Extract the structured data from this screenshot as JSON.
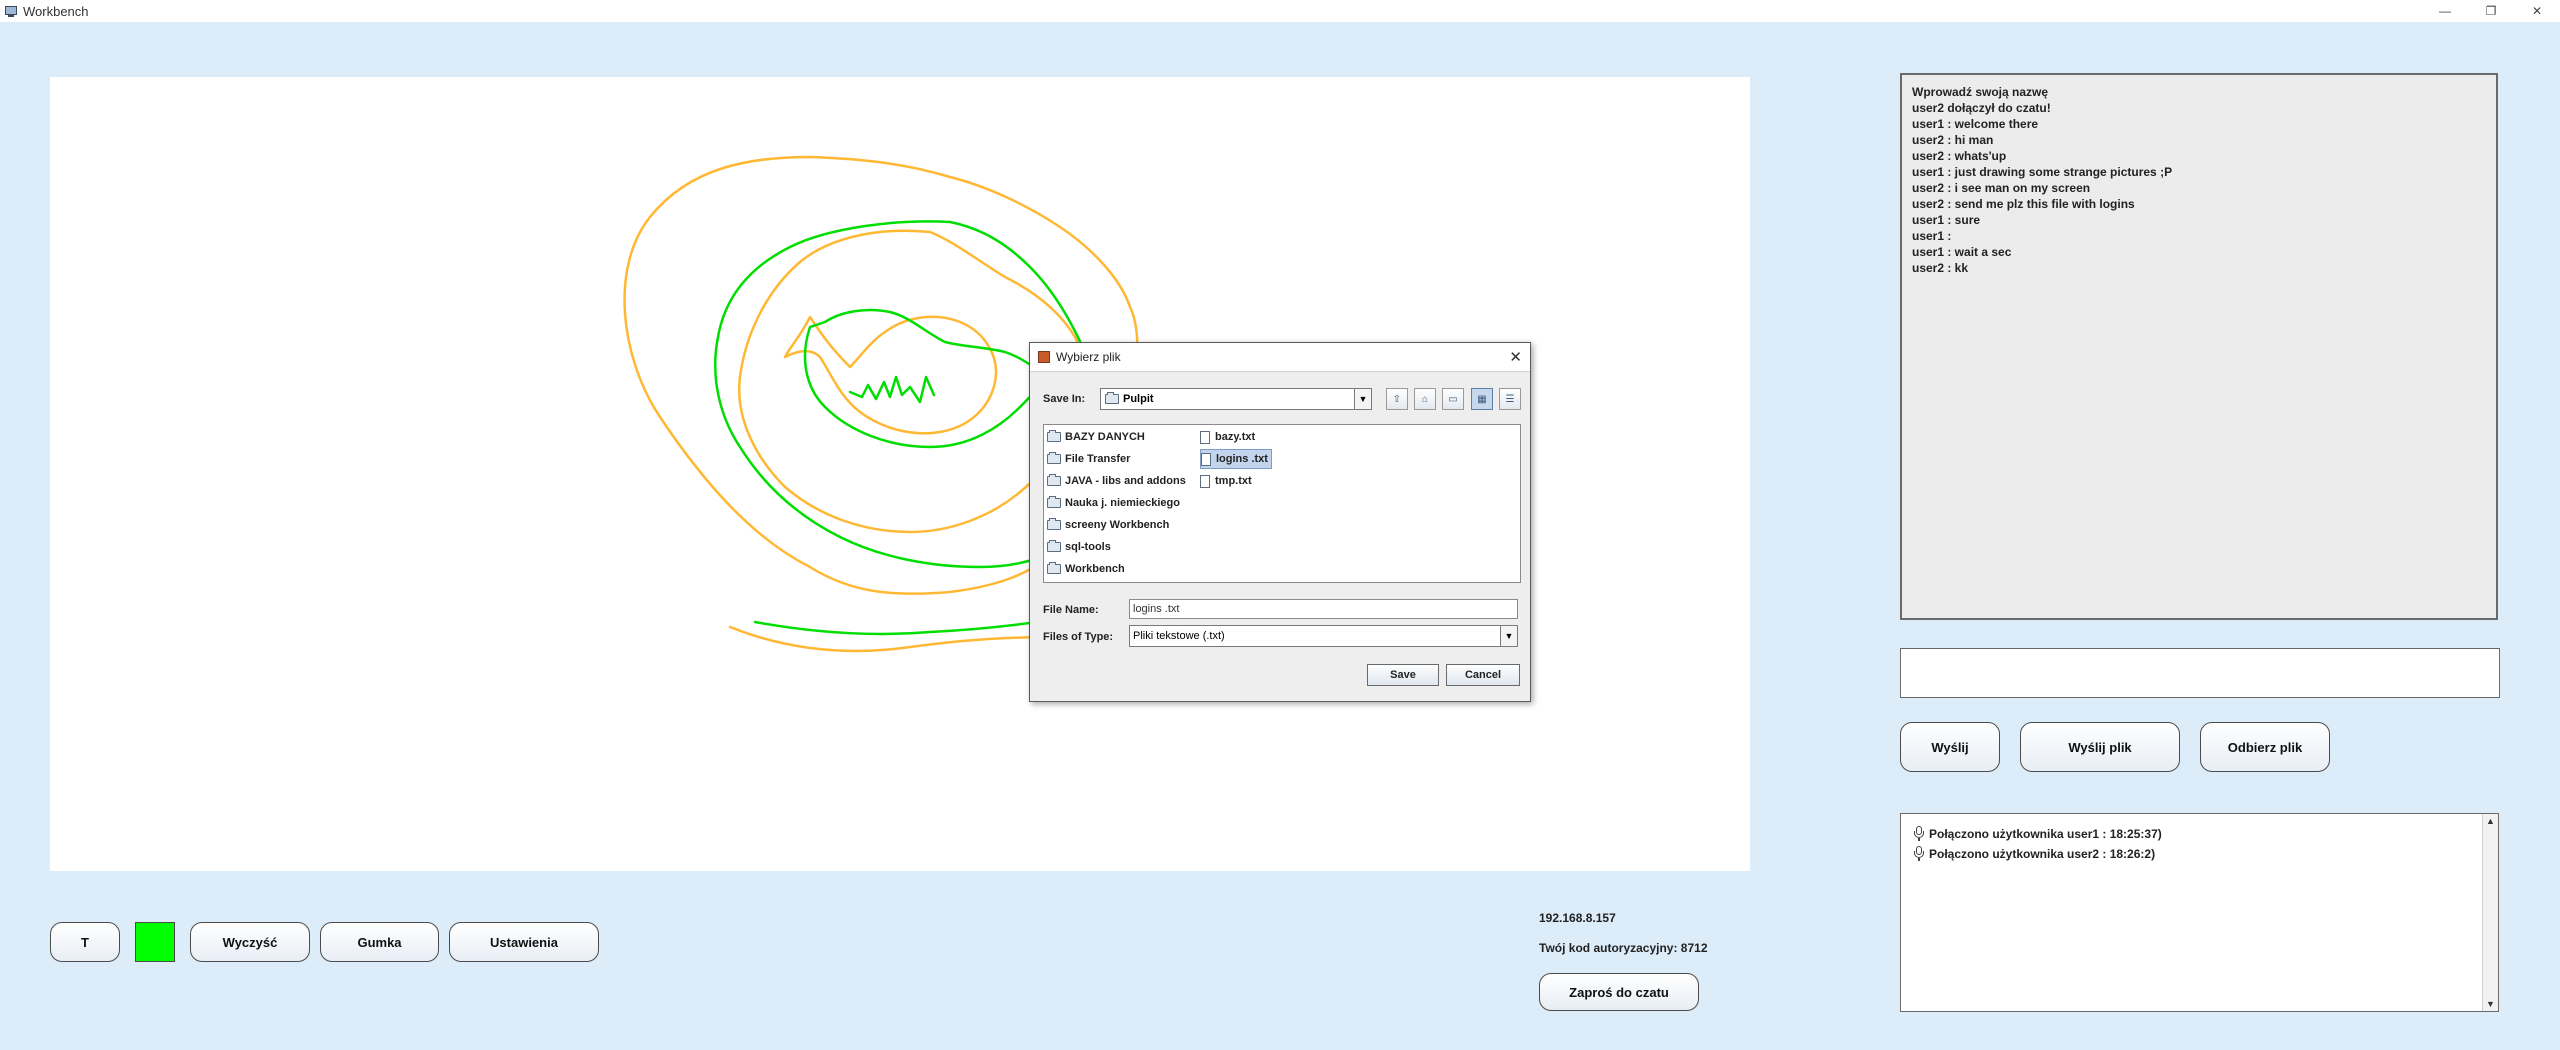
{
  "window": {
    "title": "Workbench",
    "controls": [
      "—",
      "❐",
      "✕"
    ]
  },
  "toolbar": {
    "text_tool_label": "T",
    "current_color": "#00ff00",
    "clear_label": "Wyczyść",
    "eraser_label": "Gumka",
    "settings_label": "Ustawienia"
  },
  "info": {
    "ip": "192.168.8.157",
    "auth_code": "Twój kod autoryzacyjny: 8712",
    "invite_label": "Zaproś do czatu"
  },
  "chat": {
    "lines": [
      "Wprowadź swoją nazwę",
      "user2 dołączył do czatu!",
      "user1 : welcome there",
      "user2 : hi man",
      "user2 : whats'up",
      "user1 : just drawing some strange pictures ;P",
      "user2 : i see man on my screen",
      "user2 : send me plz this file with logins",
      "user1 : sure",
      "user1 : ",
      "user1 : wait a sec",
      "user2 : kk"
    ],
    "input_value": "",
    "send_label": "Wyślij",
    "send_file_label": "Wyślij plik",
    "receive_file_label": "Odbierz plik"
  },
  "status": {
    "lines": [
      "Połączono użytkownika user1 : 18:25:37)",
      "Połączono użytkownika user2 : 18:26:2)"
    ]
  },
  "dialog": {
    "title": "Wybierz plik",
    "close": "✕",
    "save_in_label": "Save In:",
    "save_in_value": "Pulpit",
    "folders": [
      "BAZY DANYCH",
      "File Transfer",
      "JAVA - libs and addons",
      "Nauka j. niemieckiego",
      "screeny Workbench",
      "sql-tools",
      "Workbench"
    ],
    "files": [
      "bazy.txt",
      "logins .txt",
      "tmp.txt"
    ],
    "selected_file": "logins .txt",
    "file_name_label": "File Name:",
    "file_name_value": "logins .txt",
    "files_of_type_label": "Files of Type:",
    "files_of_type_value": "Pliki tekstowe (.txt)",
    "save_label": "Save",
    "cancel_label": "Cancel"
  },
  "colors": {
    "background": "#dcecf9",
    "stroke_green": "#00dd00",
    "stroke_orange": "#ffb833"
  }
}
